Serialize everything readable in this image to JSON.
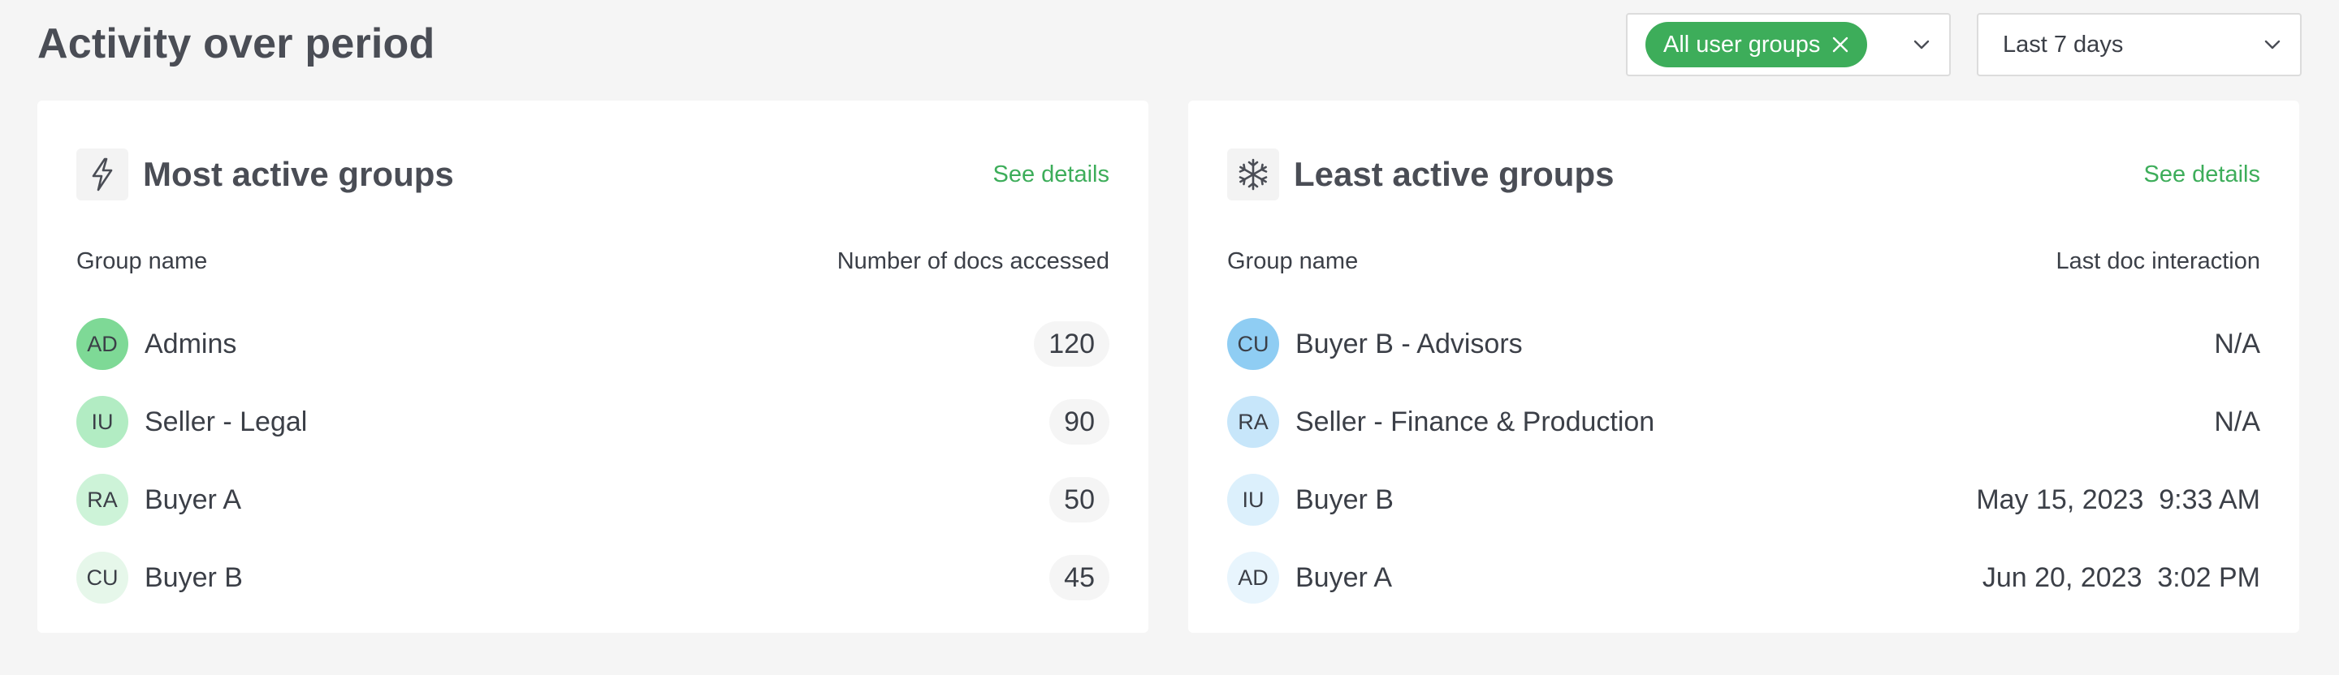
{
  "header": {
    "title": "Activity over period"
  },
  "filters": {
    "group_chip": "All user groups",
    "period": "Last 7 days"
  },
  "most_active": {
    "title": "Most active groups",
    "see_details": "See details",
    "col_name": "Group name",
    "col_value": "Number of docs accessed",
    "rows": [
      {
        "initials": "AD",
        "name": "Admins",
        "value": "120",
        "color": "#7ed996"
      },
      {
        "initials": "IU",
        "name": "Seller - Legal",
        "value": "90",
        "color": "#b2ecc3"
      },
      {
        "initials": "RA",
        "name": "Buyer A",
        "value": "50",
        "color": "#cdf3d8"
      },
      {
        "initials": "CU",
        "name": "Buyer B",
        "value": "45",
        "color": "#e6f7ea"
      }
    ]
  },
  "least_active": {
    "title": "Least active groups",
    "see_details": "See details",
    "col_name": "Group name",
    "col_value": "Last doc interaction",
    "rows": [
      {
        "initials": "CU",
        "name": "Buyer B - Advisors",
        "value": "N/A",
        "color": "#8fcdf3"
      },
      {
        "initials": "RA",
        "name": "Seller - Finance & Production",
        "value": "N/A",
        "color": "#c7e6fa"
      },
      {
        "initials": "IU",
        "name": "Buyer B",
        "value": "May 15, 2023  9:33 AM",
        "color": "#dcf0fc"
      },
      {
        "initials": "AD",
        "name": "Buyer A",
        "value": "Jun 20, 2023  3:02 PM",
        "color": "#e8f5fd"
      }
    ]
  },
  "colors": {
    "accent": "#3dad5a"
  }
}
